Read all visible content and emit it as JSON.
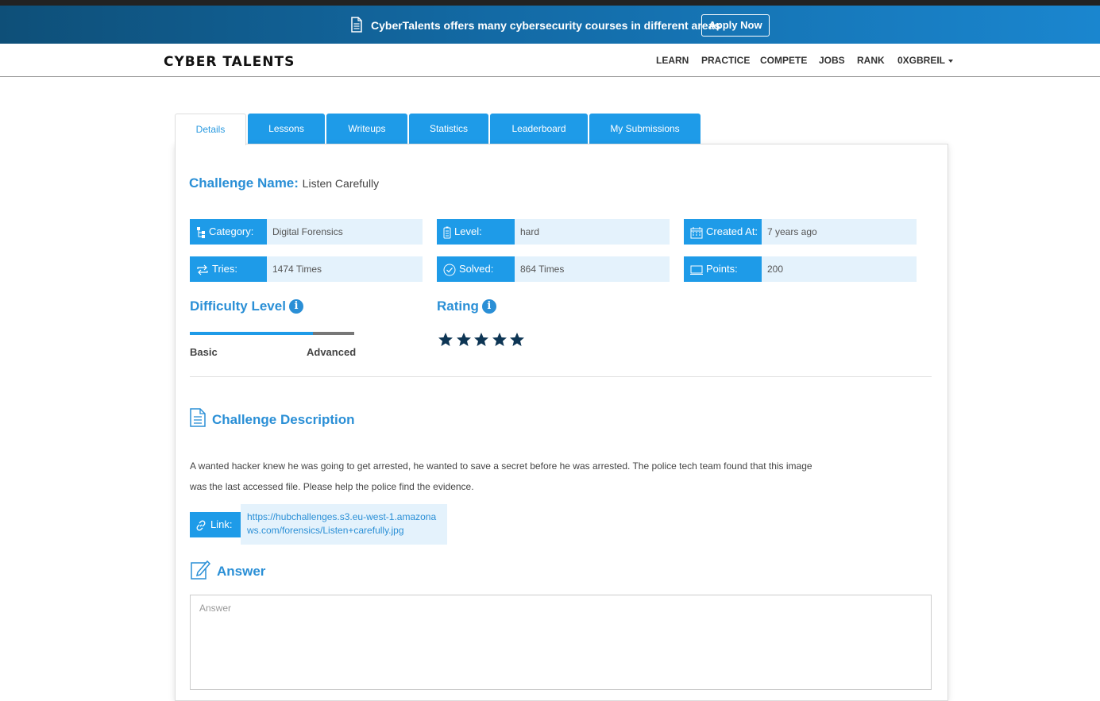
{
  "banner": {
    "text": "CyberTalents offers many cybersecurity courses in different areas",
    "apply_label": "Apply Now",
    "icon": "document-icon"
  },
  "nav": {
    "logo": "CYBER TALENTS",
    "items": [
      "LEARN",
      "PRACTICE",
      "COMPETE",
      "JOBS",
      "RANK"
    ],
    "user": "0XGBREIL"
  },
  "tabs": [
    "Details",
    "Lessons",
    "Writeups",
    "Statistics",
    "Leaderboard",
    "My Submissions"
  ],
  "challenge": {
    "name_label": "Challenge Name:",
    "name": "Listen Carefully"
  },
  "info": {
    "category_label": "Category:",
    "category": "Digital Forensics",
    "level_label": "Level:",
    "level": "hard",
    "created_label": "Created At:",
    "created": "7 years ago",
    "tries_label": "Tries:",
    "tries": "1474 Times",
    "solved_label": "Solved:",
    "solved": "864 Times",
    "points_label": "Points:",
    "points": "200"
  },
  "difficulty": {
    "title": "Difficulty Level",
    "min_label": "Basic",
    "max_label": "Advanced",
    "fraction": 0.75
  },
  "rating": {
    "title": "Rating",
    "stars": 5,
    "max": 5
  },
  "description": {
    "title": "Challenge Description",
    "text": "A wanted hacker knew he was going to get arrested, he wanted to save a secret before he was arrested. The police tech team found that this image was the last accessed file. Please help the police find the evidence.",
    "link_label": "Link:",
    "link": "https://hubchallenges.s3.eu-west-1.amazonaws.com/forensics/Listen+carefully.jpg"
  },
  "answer": {
    "title": "Answer",
    "placeholder": "Answer"
  },
  "colors": {
    "accent": "#1e9be8",
    "heading": "#2a8fd6",
    "star": "#0d3554"
  }
}
